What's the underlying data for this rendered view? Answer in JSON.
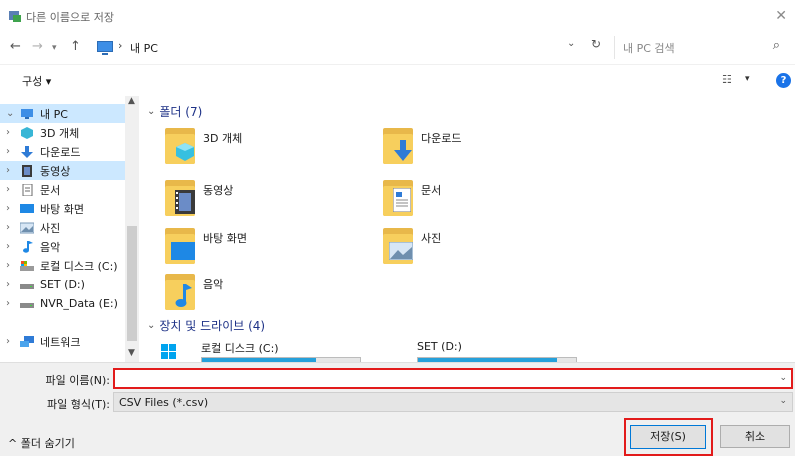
{
  "window": {
    "title": "다른 이름으로 저장",
    "close_glyph": "✕"
  },
  "address": {
    "path_label": "내 PC",
    "search_placeholder": "내 PC 검색"
  },
  "toolbar": {
    "organize_label": "구성 ▾"
  },
  "sidebar": {
    "items": [
      {
        "label": "내 PC",
        "icon": "pc-icon",
        "expanded": true
      },
      {
        "label": "3D 개체",
        "icon": "3d-objects-icon"
      },
      {
        "label": "다운로드",
        "icon": "download-icon"
      },
      {
        "label": "동영상",
        "icon": "video-icon",
        "selected": true
      },
      {
        "label": "문서",
        "icon": "document-icon"
      },
      {
        "label": "바탕 화면",
        "icon": "desktop-icon"
      },
      {
        "label": "사진",
        "icon": "pictures-icon"
      },
      {
        "label": "음악",
        "icon": "music-icon"
      },
      {
        "label": "로컬 디스크 (C:)",
        "icon": "local-disk-icon"
      },
      {
        "label": "SET (D:)",
        "icon": "drive-icon"
      },
      {
        "label": "NVR_Data (E:)",
        "icon": "drive-icon"
      },
      {
        "label": "네트워크",
        "icon": "network-icon"
      }
    ]
  },
  "main": {
    "folders_header": "폴더 (7)",
    "folders": [
      {
        "name": "3D 개체",
        "icon": "3d-objects-folder-icon"
      },
      {
        "name": "다운로드",
        "icon": "download-folder-icon"
      },
      {
        "name": "동영상",
        "icon": "video-folder-icon"
      },
      {
        "name": "문서",
        "icon": "document-folder-icon"
      },
      {
        "name": "바탕 화면",
        "icon": "desktop-folder-icon"
      },
      {
        "name": "사진",
        "icon": "pictures-folder-icon"
      },
      {
        "name": "음악",
        "icon": "music-folder-icon"
      }
    ],
    "drives_header": "장치 및 드라이브 (4)",
    "drives": [
      {
        "name": "로컬 디스크 (C:)",
        "used_fraction": 0.72
      },
      {
        "name": "SET (D:)",
        "used_fraction": 0.88
      }
    ]
  },
  "footer": {
    "filename_label": "파일 이름(N):",
    "filename_value": "",
    "filetype_label": "파일 형식(T):",
    "filetype_value": "CSV Files (*.csv)",
    "hide_folders_label": "^ 폴더 숨기기",
    "save_label": "저장(S)",
    "cancel_label": "취소"
  },
  "colors": {
    "highlight_red": "#e21b1b",
    "selection_blue": "#cce8ff",
    "folder_yellow": "#f7cf5d",
    "drive_fill": "#26a0da"
  }
}
